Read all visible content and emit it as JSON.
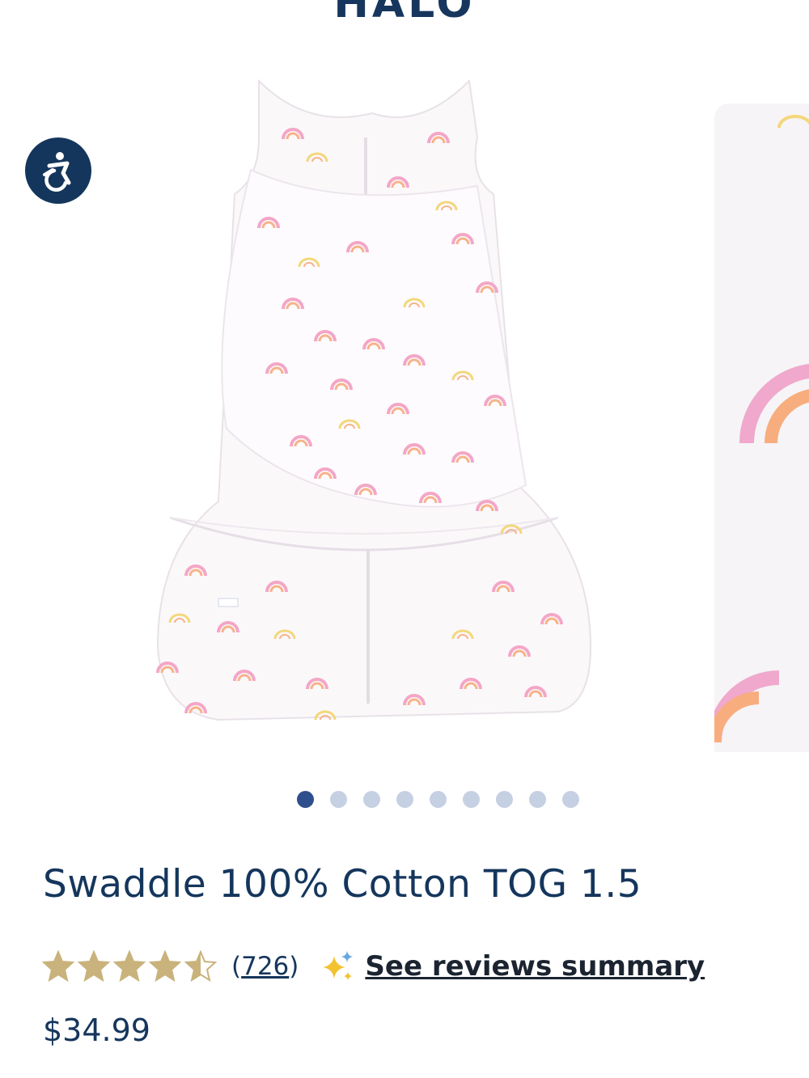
{
  "header": {
    "brand": "HALO"
  },
  "gallery": {
    "main_image_alt": "",
    "dot_count": 9,
    "active_index": 0
  },
  "accessibility": {
    "icon": "accessibility-icon"
  },
  "product": {
    "title": "Swaddle 100% Cotton TOG 1.5",
    "rating": 4.5,
    "review_count_open": "(",
    "review_count": "726",
    "review_count_close": ")",
    "reviews_link": "See reviews summary",
    "price": "$34.99"
  },
  "colors": {
    "brand_navy": "#15365c",
    "dot_active": "#2f4f8c",
    "dot_inactive": "#c5d0e3",
    "star_gold": "#c9b27c"
  }
}
